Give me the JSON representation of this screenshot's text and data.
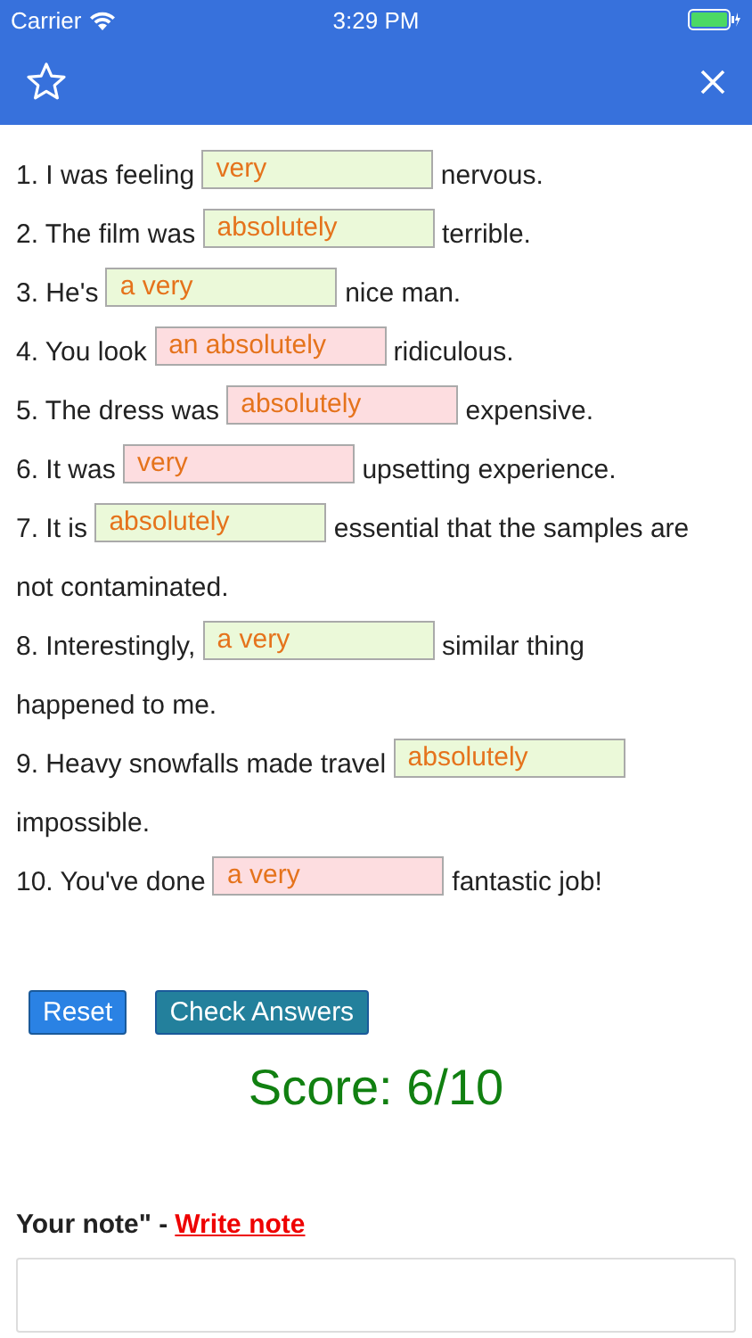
{
  "status_bar": {
    "carrier": "Carrier",
    "time": "3:29 PM"
  },
  "questions": [
    {
      "before": "1. I was feeling",
      "answer": "very",
      "after": "nervous.",
      "correct": true
    },
    {
      "before": "2. The film was",
      "answer": "absolutely",
      "after": "terrible.",
      "correct": true
    },
    {
      "before": "3. He's",
      "answer": "a very",
      "after": "nice man.",
      "correct": true
    },
    {
      "before": "4. You look",
      "answer": "an absolutely",
      "after": "ridiculous.",
      "correct": false
    },
    {
      "before": "5. The dress was",
      "answer": "absolutely",
      "after": "expensive.",
      "correct": false
    },
    {
      "before": "6. It was",
      "answer": "very",
      "after": "upsetting experience.",
      "correct": false
    },
    {
      "before": "7. It is",
      "answer": "absolutely",
      "after": "essential that the samples are",
      "after_next_line": "not contaminated.",
      "correct": true
    },
    {
      "before": "8. Interestingly,",
      "answer": "a very",
      "after": "similar thing",
      "after_next_line": "happened to me.",
      "correct": true
    },
    {
      "before": "9. Heavy snowfalls made travel",
      "answer": "absolutely",
      "after_next_line": "impossible.",
      "correct": true
    },
    {
      "before": "10. You've done",
      "answer": "a very",
      "after": "fantastic job!",
      "correct": false
    }
  ],
  "buttons": [
    {
      "label": "Reset",
      "kind": "reset"
    },
    {
      "label": "Check Answers",
      "kind": "check"
    }
  ],
  "score": "Score: 6/10",
  "note": {
    "label": "Your note\" -",
    "link": "Write note"
  }
}
